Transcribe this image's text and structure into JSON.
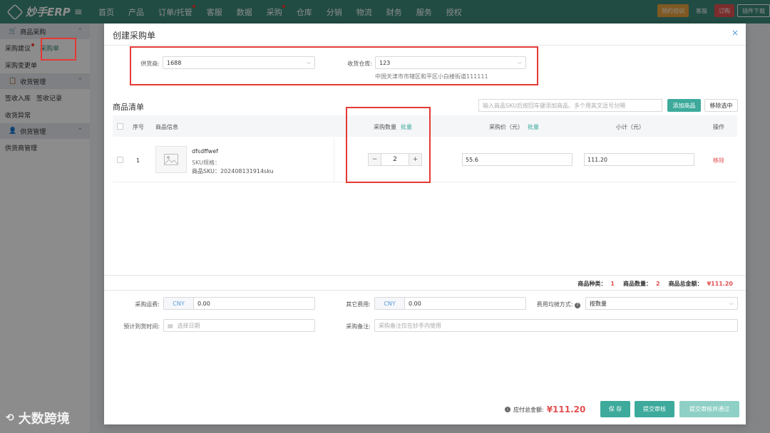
{
  "app": {
    "logo_text": "妙手ERP"
  },
  "nav": {
    "items": [
      "首页",
      "产品",
      "订单/托管",
      "客服",
      "数据",
      "采购",
      "仓库",
      "分销",
      "物流",
      "财务",
      "服务",
      "授权"
    ],
    "training": "预约培训",
    "service": "客服",
    "order": "订购",
    "plugin": "插件下载"
  },
  "sidebar": {
    "group_purchase": "商品采购",
    "item_suggest": "采购建议",
    "item_order": "采购单",
    "item_change": "采购变更单",
    "group_receive": "收货管理",
    "item_sign_in": "签收入库",
    "item_sign_record": "签收记录",
    "item_receive_exception": "收货异常",
    "group_supplier": "供货管理",
    "item_supplier_mgmt": "供货商管理"
  },
  "modal": {
    "title": "创建采购单",
    "close": "×",
    "supplier_label": "供货商:",
    "supplier_value": "1688",
    "warehouse_label": "收货仓库:",
    "warehouse_value": "123",
    "warehouse_address": "中国天津市市辖区和平区小白楼街道111111",
    "list_title": "商品清单",
    "sku_placeholder": "输入商品SKU后按回车键添加商品、多个用英文逗号分隔",
    "add_product": "添加商品",
    "remove_selected": "移除选中",
    "columns": {
      "no": "序号",
      "info": "商品信息",
      "qty": "采购数量",
      "qty_batch": "批量",
      "price": "采购价（元）",
      "price_batch": "批量",
      "subtotal": "小计（元）",
      "action": "操作"
    },
    "rows": [
      {
        "no": "1",
        "name": "dfsdffwef",
        "spec": "SKU规格：",
        "sku": "商品SKU：202408131914sku",
        "qty": "2",
        "price": "55.6",
        "subtotal": "111.20",
        "action": "移除"
      }
    ],
    "summary": {
      "kinds_label": "商品种类：",
      "kinds": "1",
      "qty_label": "商品数量：",
      "qty": "2",
      "total_label": "商品总金额：",
      "total": "¥111.20"
    },
    "freight_label": "采购运费:",
    "freight_currency": "CNY",
    "freight_value": "0.00",
    "other_label": "其它费用:",
    "other_currency": "CNY",
    "other_value": "0.00",
    "split_label": "费用均摊方式:",
    "split_value": "按数量",
    "eta_label": "预计到货时间:",
    "eta_placeholder": "选择日期",
    "remark_label": "采购备注:",
    "remark_placeholder": "采购备注仅在妙手内使用",
    "payable_label": "应付总金额:",
    "payable_value": "¥111.20",
    "save": "保 存",
    "submit_review": "提交审核",
    "submit_approve": "提交审核并通过"
  },
  "watermark": "大数跨境"
}
